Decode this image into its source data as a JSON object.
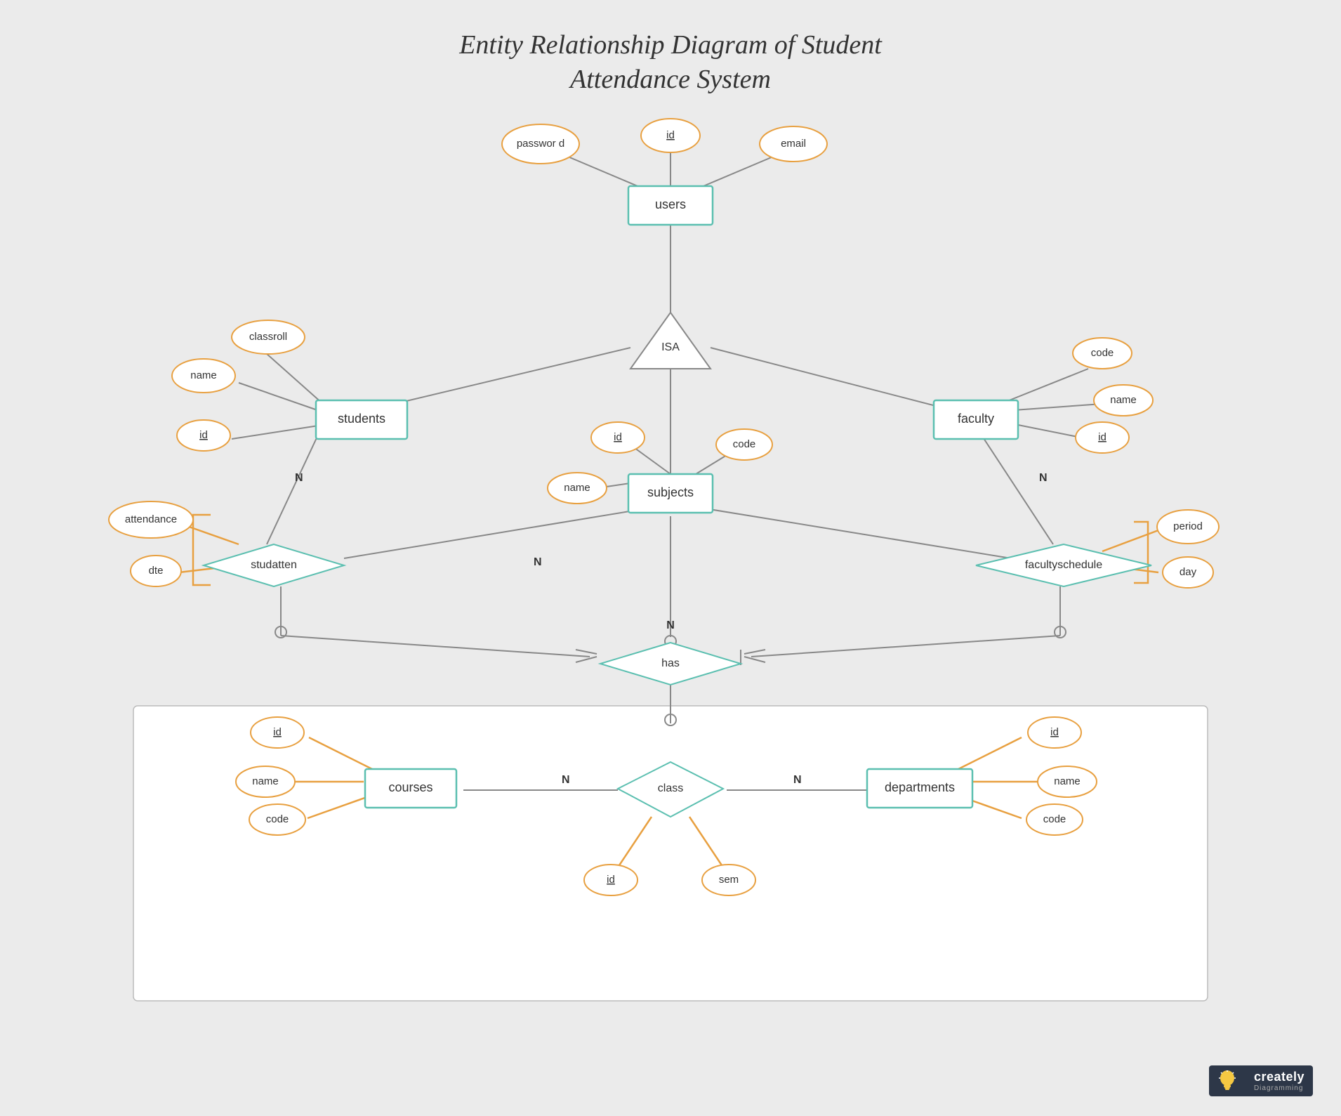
{
  "title": {
    "line1": "Entity Relationship Diagram of Student",
    "line2": "Attendance System"
  },
  "entities": {
    "users": "users",
    "students": "students",
    "faculty": "faculty",
    "subjects": "subjects",
    "courses": "courses",
    "departments": "departments"
  },
  "relationships": {
    "isa": "ISA",
    "studatten": "studatten",
    "facultyschedule": "facultyschedule",
    "has": "has",
    "class": "class"
  },
  "attributes": {
    "users_id": "id",
    "users_password": "password",
    "users_email": "email",
    "students_name": "name",
    "students_classroll": "classroll",
    "students_id": "id",
    "faculty_code": "code",
    "faculty_name": "name",
    "faculty_id": "id",
    "subjects_id": "id",
    "subjects_name": "name",
    "subjects_code": "code",
    "attendance": "attendance",
    "dte": "dte",
    "period": "period",
    "day": "day",
    "courses_id": "id",
    "courses_name": "name",
    "courses_code": "code",
    "departments_id": "id",
    "departments_name": "name",
    "departments_code": "code",
    "class_id": "id",
    "class_sem": "sem"
  },
  "logo": {
    "brand": "creately",
    "sub": "Diagramming"
  }
}
